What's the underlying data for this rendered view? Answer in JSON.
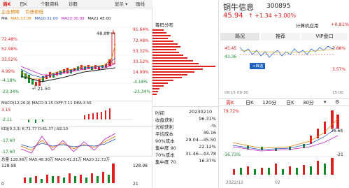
{
  "left": {
    "tabs": [
      "周K",
      "日K",
      "个股资料",
      "诊股",
      "显示",
      "画线"
    ],
    "sub_links": [
      "企业预降",
      "负债很低"
    ],
    "ma_legend": {
      "ma": "MA",
      "ma5": "MA5:33.08",
      "ma10": "MA10:31.00",
      "ma20": "MA20:30.99",
      "ma21": "MA21 48.00"
    },
    "price_ticks_left": [
      "72.48%",
      "52.98%",
      "33.52%",
      "14.99%",
      "-4.18%",
      "-23.34%"
    ],
    "price_ticks_right": [
      "91.64%",
      "72.48%",
      "53.32%",
      "33.52%",
      "14.99%",
      "-4.18%",
      "-23.34%"
    ],
    "price_values_left": [
      "4.99%"
    ],
    "high_label": "48.00",
    "low_label": "21.50",
    "macd_legend": "MACD(12,26,9) MACD:3.15 DIFF:7.11 DEA:3.56",
    "macd_ticks": [
      "3.15",
      "-2.11"
    ],
    "kdj_legend": "KDJ(9,3,3) K:71.77 D:61.37 J:92.10",
    "kdj_ticks": [
      "-17.60",
      "-17.60"
    ],
    "vol_legend": "总量:128.98万 MA5:48.30万 MA10:41.21万 MA20:32.72万",
    "vol_ticks": [
      "128.98",
      "0"
    ],
    "date_label": "21"
  },
  "mid": {
    "title": "筹码分布",
    "date_label": "时间",
    "date_value": "20230210",
    "rows": [
      {
        "label": "收盘获利",
        "value": "96.31%"
      },
      {
        "label": "光标获利",
        "value": "-%"
      },
      {
        "label": "平均成本",
        "value": "39.16"
      },
      {
        "label": "90%成本",
        "value": "29.04—45.50"
      },
      {
        "label": "集中度 90",
        "value": "22.12%"
      },
      {
        "label": "70%成本",
        "value": "31.46—43.78"
      },
      {
        "label": "集中度 70",
        "value": "16.37%"
      }
    ]
  },
  "right": {
    "stock_name": "铜牛信息",
    "stock_code": "300895",
    "price": "45.94",
    "change": "↑ +1.34",
    "change_pct": "+3.00%",
    "calc_label": "计算机应用",
    "calc_value": "+0.81%",
    "tabs_top": [
      "简况",
      "推荐",
      "VIP盘口"
    ],
    "intraday_ticks_left": [
      "45.45",
      "43.36"
    ],
    "intraday_ticks_right": [
      "7.88%",
      "3.57%"
    ],
    "add_button": "+自选",
    "time_labels": [
      "09:15",
      "09:30",
      "15:00"
    ],
    "period_tabs": [
      "周K",
      "日K",
      "120分",
      "日K",
      "30分"
    ],
    "kline_ticks_left": [
      "79.72%",
      "-16.73%"
    ],
    "kline_ticks_right": [
      "26.68",
      "-21"
    ],
    "date_labels": [
      "2022/12",
      "02"
    ],
    "colors": {
      "up": "#e02020",
      "down": "#128a2a",
      "accent": "#2060c0"
    }
  }
}
